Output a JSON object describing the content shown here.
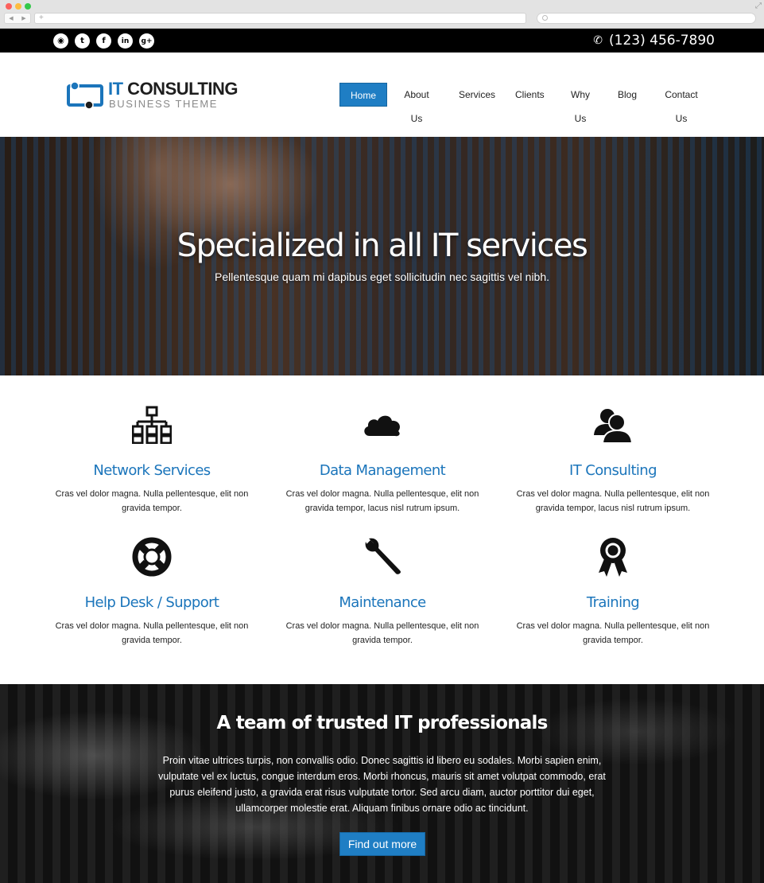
{
  "browser": {
    "new_tab_symbol": "+",
    "back_symbol": "◀",
    "forward_symbol": "▶",
    "expand_symbol": "⤢"
  },
  "topbar": {
    "social_icons": [
      "rss-icon",
      "twitter-icon",
      "facebook-icon",
      "linkedin-icon",
      "googleplus-icon"
    ],
    "social_glyphs": {
      "rss": "◉",
      "twitter": "t",
      "facebook": "f",
      "linkedin": "in",
      "googleplus": "g+"
    },
    "phone_glyph": "✆",
    "phone": "(123) 456-7890"
  },
  "header": {
    "logo_it": "IT",
    "logo_consulting": " CONSULTING",
    "logo_subtitle": "BUSINESS THEME",
    "nav": [
      "Home",
      "About Us",
      "Services",
      "Clients",
      "Why Us",
      "Blog",
      "Contact Us"
    ],
    "active_nav": "Home"
  },
  "hero": {
    "title": "Specialized in all IT services",
    "subtitle": "Pellentesque quam mi dapibus eget sollicitudin nec sagittis vel nibh."
  },
  "services": [
    {
      "icon": "network-icon",
      "title": "Network Services",
      "desc": "Cras vel dolor magna. Nulla pellentesque, elit non gravida tempor."
    },
    {
      "icon": "cloud-icon",
      "title": "Data Management",
      "desc": "Cras vel dolor magna. Nulla pellentesque, elit non gravida tempor, lacus nisl rutrum ipsum."
    },
    {
      "icon": "users-icon",
      "title": "IT Consulting",
      "desc": "Cras vel dolor magna. Nulla pellentesque, elit non gravida tempor, lacus nisl rutrum ipsum."
    },
    {
      "icon": "lifebuoy-icon",
      "title": "Help Desk / Support",
      "desc": "Cras vel dolor magna. Nulla pellentesque, elit non gravida tempor."
    },
    {
      "icon": "wrench-icon",
      "title": "Maintenance",
      "desc": "Cras vel dolor magna. Nulla pellentesque, elit non gravida tempor."
    },
    {
      "icon": "award-icon",
      "title": "Training",
      "desc": "Cras vel dolor magna. Nulla pellentesque, elit non gravida tempor."
    }
  ],
  "team": {
    "title": "A team of trusted IT professionals",
    "text": "Proin vitae ultrices turpis, non convallis odio. Donec sagittis id libero eu sodales. Morbi sapien enim, vulputate vel ex luctus, congue interdum eros. Morbi rhoncus, mauris sit amet volutpat commodo, erat purus eleifend justo, a gravida erat risus vulputate tortor. Sed arcu diam, auctor porttitor dui eget, ullamcorper molestie erat. Aliquam finibus ornare odio ac tincidunt.",
    "button": "Find out more"
  },
  "colors": {
    "accent": "#1f7ec4",
    "title_blue": "#1b75bb",
    "topbar": "#000000"
  }
}
